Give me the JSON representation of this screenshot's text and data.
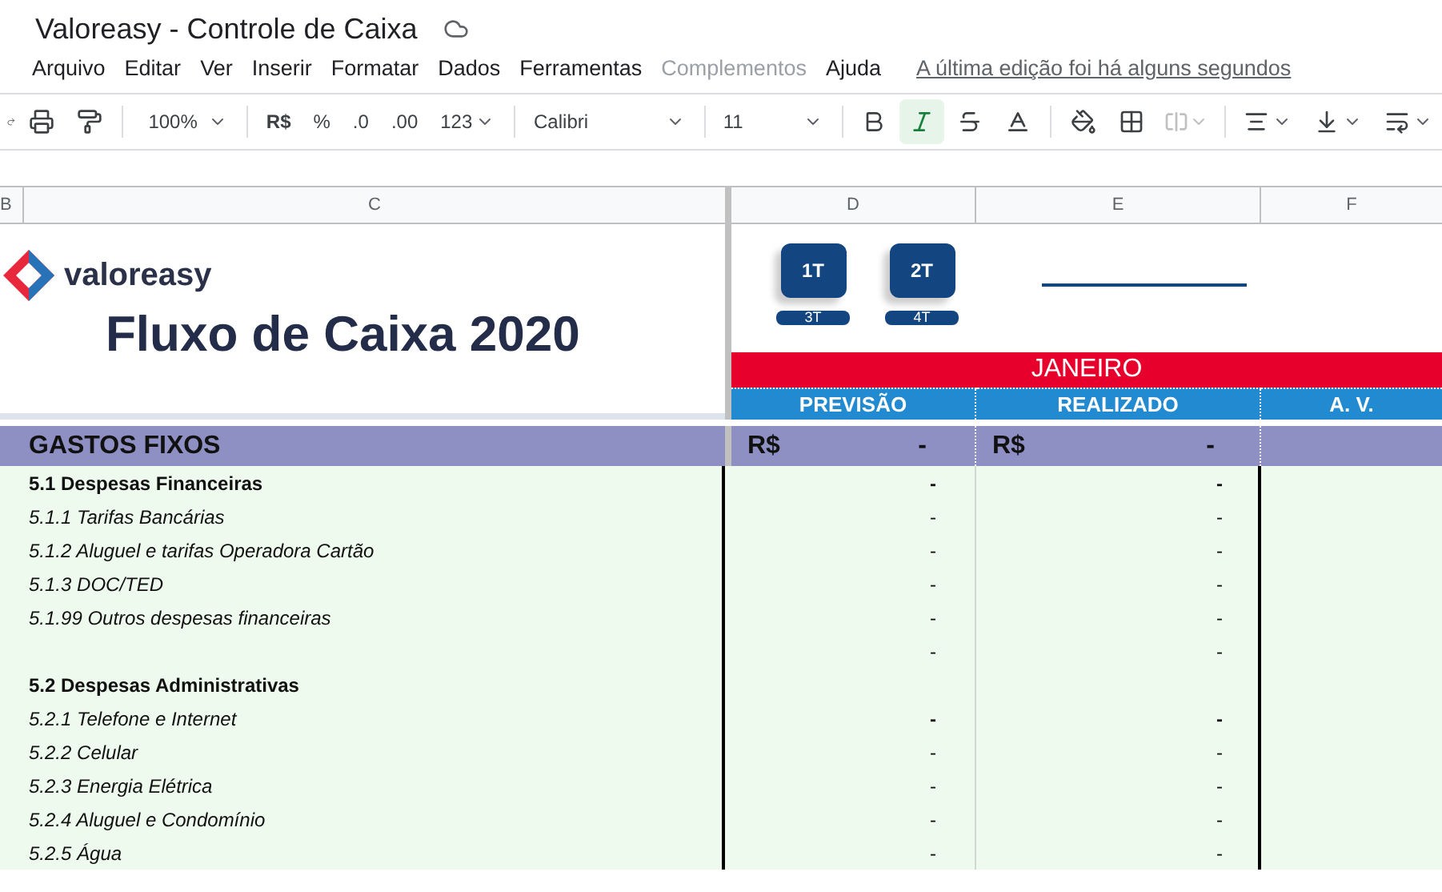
{
  "title": "Valoreasy - Controle de Caixa",
  "menu": [
    {
      "label": "Arquivo",
      "disabled": false
    },
    {
      "label": "Editar",
      "disabled": false
    },
    {
      "label": "Ver",
      "disabled": false
    },
    {
      "label": "Inserir",
      "disabled": false
    },
    {
      "label": "Formatar",
      "disabled": false
    },
    {
      "label": "Dados",
      "disabled": false
    },
    {
      "label": "Ferramentas",
      "disabled": false
    },
    {
      "label": "Complementos",
      "disabled": true
    },
    {
      "label": "Ajuda",
      "disabled": false
    }
  ],
  "last_edit": "A última edição foi há alguns segundos",
  "toolbar": {
    "zoom": "100%",
    "currency": "R$",
    "percent": "%",
    "dec_less": ".0",
    "dec_more": ".00",
    "format": "123",
    "font": "Calibri",
    "size": "11",
    "bold": false,
    "italic": true,
    "strike": false
  },
  "column_headers": [
    "B",
    "C",
    "D",
    "E",
    "F"
  ],
  "logo": "valoreasy",
  "sheet_title": "Fluxo de Caixa 2020",
  "quarters": [
    "1T",
    "2T",
    "3T",
    "4T"
  ],
  "month": "JANEIRO",
  "subheaders": [
    "PREVISÃO",
    "REALIZADO",
    "A. V."
  ],
  "group": {
    "label": "GASTOS FIXOS",
    "currency_d": "R$",
    "value_d": "-",
    "currency_e": "R$",
    "value_e": "-"
  },
  "rows": [
    {
      "kind": "section",
      "label": "5.1 Despesas Financeiras",
      "d": "-",
      "e": "-",
      "bold_values": true
    },
    {
      "kind": "item",
      "label": "5.1.1 Tarifas Bancárias",
      "d": "-",
      "e": "-",
      "bold_values": false
    },
    {
      "kind": "item",
      "label": "5.1.2 Aluguel e tarifas Operadora Cartão",
      "d": "-",
      "e": "-",
      "bold_values": false
    },
    {
      "kind": "item",
      "label": "5.1.3 DOC/TED",
      "d": "-",
      "e": "-",
      "bold_values": false
    },
    {
      "kind": "item",
      "label": "5.1.99 Outros despesas financeiras",
      "d": "-",
      "e": "-",
      "bold_values": false
    },
    {
      "kind": "blank",
      "d": "-",
      "e": "-",
      "bold_values": false
    },
    {
      "kind": "section",
      "label": "5.2 Despesas Administrativas"
    },
    {
      "kind": "item",
      "label": "5.2.1 Telefone e Internet",
      "d": "-",
      "e": "-",
      "bold_values": true
    },
    {
      "kind": "item",
      "label": "5.2.2 Celular",
      "d": "-",
      "e": "-",
      "bold_values": false
    },
    {
      "kind": "item",
      "label": "5.2.3 Energia Elétrica",
      "d": "-",
      "e": "-",
      "bold_values": false
    },
    {
      "kind": "item",
      "label": "5.2.4 Aluguel e Condomínio",
      "d": "-",
      "e": "-",
      "bold_values": false
    },
    {
      "kind": "item",
      "label": "5.2.5 Água",
      "d": "-",
      "e": "-",
      "bold_values": false
    }
  ]
}
